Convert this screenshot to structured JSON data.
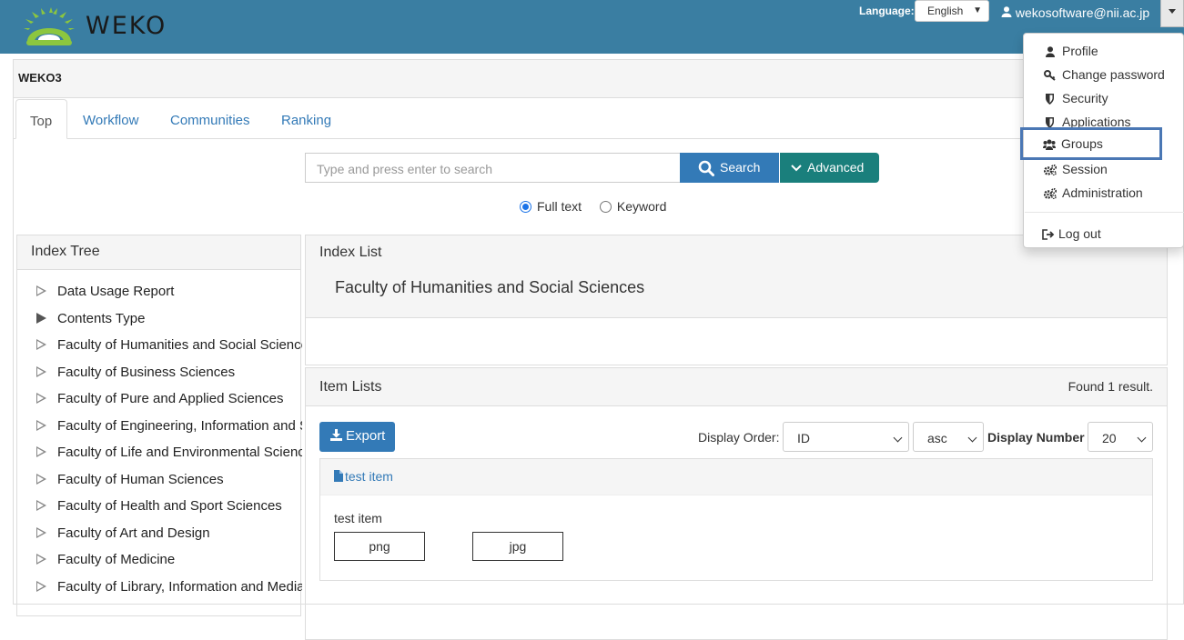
{
  "header": {
    "brand": "WEKO",
    "language_label": "Language:",
    "language_value": "English",
    "user_email": "wekosoftware@nii.ac.jp"
  },
  "user_menu": {
    "items": [
      {
        "label": "Profile",
        "icon": "user-icon"
      },
      {
        "label": "Change password",
        "icon": "key-icon"
      },
      {
        "label": "Security",
        "icon": "shield-icon"
      },
      {
        "label": "Applications",
        "icon": "shield-icon"
      },
      {
        "label": "Groups",
        "icon": "users-icon"
      },
      {
        "label": "Session",
        "icon": "gears-icon"
      },
      {
        "label": "Administration",
        "icon": "gears-icon"
      }
    ],
    "logout": {
      "label": "Log out",
      "icon": "sign-out-icon"
    },
    "highlighted": "Groups"
  },
  "panel": {
    "title": "WEKO3"
  },
  "tabs": [
    {
      "label": "Top",
      "active": true
    },
    {
      "label": "Workflow",
      "active": false
    },
    {
      "label": "Communities",
      "active": false
    },
    {
      "label": "Ranking",
      "active": false
    }
  ],
  "search": {
    "placeholder": "Type and press enter to search",
    "search_label": "Search",
    "advanced_label": "Advanced",
    "options": [
      {
        "label": "Full text",
        "checked": true
      },
      {
        "label": "Keyword",
        "checked": false
      }
    ]
  },
  "index_tree": {
    "title": "Index Tree",
    "items": [
      {
        "label": "Data Usage Report",
        "filled": false
      },
      {
        "label": "Contents Type",
        "filled": true
      },
      {
        "label": "Faculty of Humanities and Social Sciences",
        "filled": false
      },
      {
        "label": "Faculty of Business Sciences",
        "filled": false
      },
      {
        "label": "Faculty of Pure and Applied Sciences",
        "filled": false
      },
      {
        "label": "Faculty of Engineering, Information and Systems",
        "filled": false
      },
      {
        "label": "Faculty of Life and Environmental Sciences",
        "filled": false
      },
      {
        "label": "Faculty of Human Sciences",
        "filled": false
      },
      {
        "label": "Faculty of Health and Sport Sciences",
        "filled": false
      },
      {
        "label": "Faculty of Art and Design",
        "filled": false
      },
      {
        "label": "Faculty of Medicine",
        "filled": false
      },
      {
        "label": "Faculty of Library, Information and Media Science",
        "filled": false
      }
    ]
  },
  "index_list": {
    "title": "Index List",
    "current": "Faculty of Humanities and Social Sciences"
  },
  "item_lists": {
    "title": "Item Lists",
    "found": "Found 1 result.",
    "export_label": "Export",
    "display_order_label": "Display Order:",
    "order_field": "ID",
    "order_dir": "asc",
    "display_number_label": "Display Number",
    "display_number": "20",
    "items": [
      {
        "title": "test item",
        "name": "test item",
        "files": [
          "png",
          "jpg"
        ]
      }
    ]
  },
  "colors": {
    "header_bg": "#3a7ea2",
    "primary": "#337ab7",
    "advanced": "#1a7f7c",
    "highlight_outline": "#4a77b4"
  }
}
